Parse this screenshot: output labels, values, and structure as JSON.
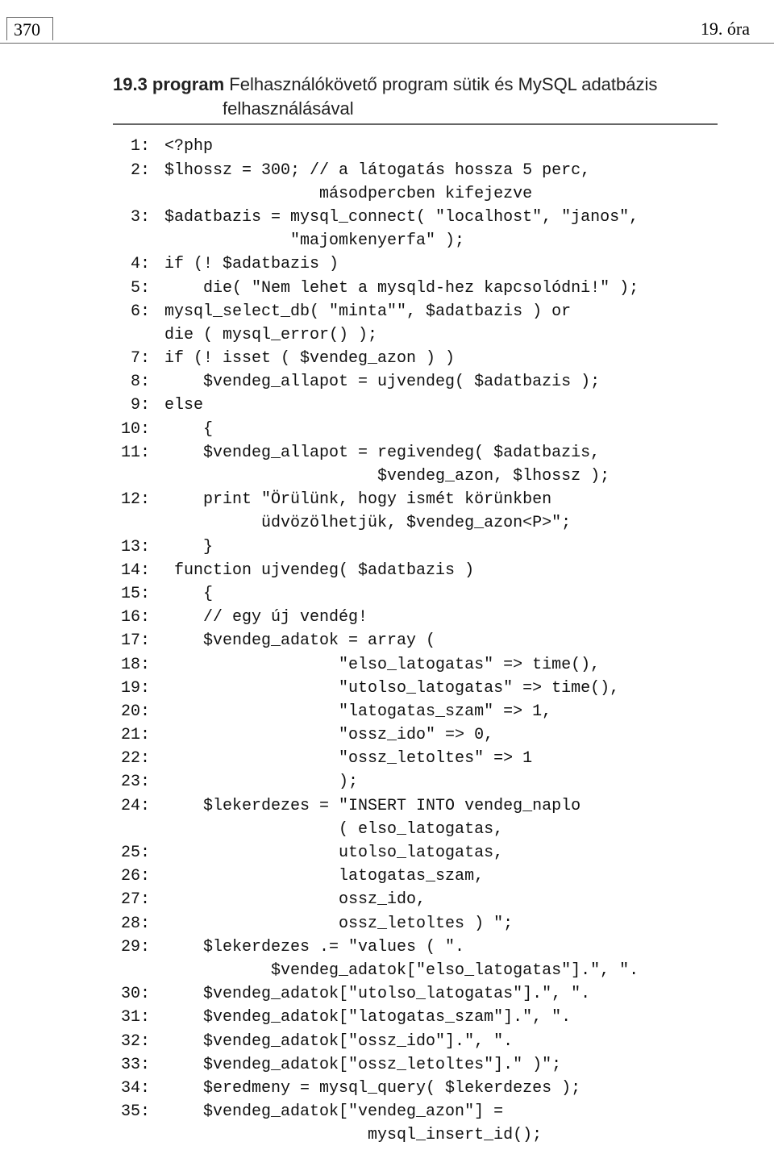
{
  "header": {
    "page_number": "370",
    "chapter": "19. óra"
  },
  "caption": {
    "prefix": "19.3 program",
    "title_line1": " Felhasználókövető program sütik és MySQL adatbázis",
    "title_line2": "felhasználásával"
  },
  "code": [
    {
      "num": "1:",
      "text": "<?php"
    },
    {
      "num": "2:",
      "text": "$lhossz = 300; // a látogatás hossza 5 perc,"
    },
    {
      "num": "",
      "text": "                másodpercben kifejezve"
    },
    {
      "num": "3:",
      "text": "$adatbazis = mysql_connect( \"localhost\", \"janos\","
    },
    {
      "num": "",
      "text": "             \"majomkenyerfa\" );"
    },
    {
      "num": "4:",
      "text": "if (! $adatbazis )"
    },
    {
      "num": "5:",
      "text": "    die( \"Nem lehet a mysqld-hez kapcsolódni!\" );"
    },
    {
      "num": "6:",
      "text": "mysql_select_db( \"minta\"\", $adatbazis ) or"
    },
    {
      "num": "",
      "text": "die ( mysql_error() );"
    },
    {
      "num": "7:",
      "text": "if (! isset ( $vendeg_azon ) )"
    },
    {
      "num": "8:",
      "text": "    $vendeg_allapot = ujvendeg( $adatbazis );"
    },
    {
      "num": "9:",
      "text": "else"
    },
    {
      "num": "10:",
      "text": "    {"
    },
    {
      "num": "11:",
      "text": "    $vendeg_allapot = regivendeg( $adatbazis,"
    },
    {
      "num": "",
      "text": "                      $vendeg_azon, $lhossz );"
    },
    {
      "num": "12:",
      "text": "    print \"Örülünk, hogy ismét körünkben"
    },
    {
      "num": "",
      "text": "          üdvözölhetjük, $vendeg_azon<P>\";"
    },
    {
      "num": "13:",
      "text": "    }"
    },
    {
      "num": "14:",
      "text": " function ujvendeg( $adatbazis )"
    },
    {
      "num": "15:",
      "text": "    {"
    },
    {
      "num": "16:",
      "text": "    // egy új vendég!"
    },
    {
      "num": "17:",
      "text": "    $vendeg_adatok = array ("
    },
    {
      "num": "18:",
      "text": "                  \"elso_latogatas\" => time(),"
    },
    {
      "num": "19:",
      "text": "                  \"utolso_latogatas\" => time(),"
    },
    {
      "num": "20:",
      "text": "                  \"latogatas_szam\" => 1,"
    },
    {
      "num": "21:",
      "text": "                  \"ossz_ido\" => 0,"
    },
    {
      "num": "22:",
      "text": "                  \"ossz_letoltes\" => 1"
    },
    {
      "num": "23:",
      "text": "                  );"
    },
    {
      "num": "24:",
      "text": "    $lekerdezes = \"INSERT INTO vendeg_naplo"
    },
    {
      "num": "",
      "text": "                  ( elso_latogatas,"
    },
    {
      "num": "25:",
      "text": "                  utolso_latogatas,"
    },
    {
      "num": "26:",
      "text": "                  latogatas_szam,"
    },
    {
      "num": "27:",
      "text": "                  ossz_ido,"
    },
    {
      "num": "28:",
      "text": "                  ossz_letoltes ) \";"
    },
    {
      "num": "29:",
      "text": "    $lekerdezes .= \"values ( \"."
    },
    {
      "num": "",
      "text": "           $vendeg_adatok[\"elso_latogatas\"].\", \"."
    },
    {
      "num": "30:",
      "text": "    $vendeg_adatok[\"utolso_latogatas\"].\", \"."
    },
    {
      "num": "31:",
      "text": "    $vendeg_adatok[\"latogatas_szam\"].\", \"."
    },
    {
      "num": "32:",
      "text": "    $vendeg_adatok[\"ossz_ido\"].\", \"."
    },
    {
      "num": "33:",
      "text": "    $vendeg_adatok[\"ossz_letoltes\"].\" )\";"
    },
    {
      "num": "34:",
      "text": "    $eredmeny = mysql_query( $lekerdezes );"
    },
    {
      "num": "35:",
      "text": "    $vendeg_adatok[\"vendeg_azon\"] ="
    },
    {
      "num": "",
      "text": "                     mysql_insert_id();"
    }
  ]
}
